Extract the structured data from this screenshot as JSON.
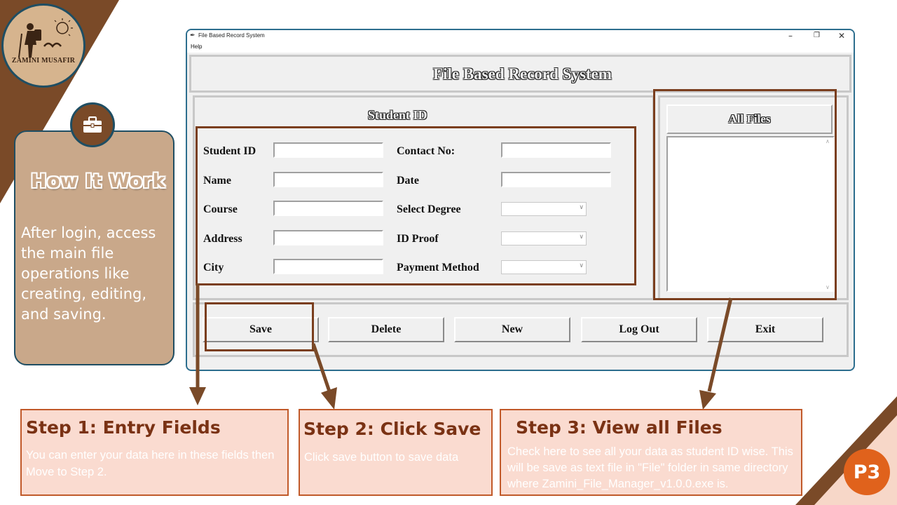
{
  "colors": {
    "accent_brown": "#7a4a28",
    "card_fill": "#c9a88a",
    "window_border": "#2d6e8e",
    "step_fill": "#fadbd0",
    "step_border": "#c15a2a",
    "badge": "#e0621c"
  },
  "logo": {
    "text": "ZAMINI MUSAFIR",
    "icon": "traveler-logo"
  },
  "how_it_works": {
    "icon": "briefcase-icon",
    "title": "How It Work",
    "description": "After login, access the main file operations like creating, editing, and saving."
  },
  "window": {
    "title": "File Based Record System",
    "controls": [
      "–",
      "❐",
      "✕"
    ],
    "menu": [
      "Help"
    ],
    "header_title": "File Based Record System",
    "form_title": "Student ID",
    "fields_left": [
      {
        "label": "Student ID",
        "value": ""
      },
      {
        "label": "Name",
        "value": ""
      },
      {
        "label": "Course",
        "value": ""
      },
      {
        "label": "Address",
        "value": ""
      },
      {
        "label": "City",
        "value": ""
      }
    ],
    "fields_right": [
      {
        "label": "Contact No:",
        "type": "entry",
        "value": ""
      },
      {
        "label": "Date",
        "type": "entry",
        "value": ""
      },
      {
        "label": "Select Degree",
        "type": "combo",
        "value": ""
      },
      {
        "label": "ID Proof",
        "type": "combo",
        "value": ""
      },
      {
        "label": "Payment Method",
        "type": "combo",
        "value": ""
      }
    ],
    "files_title": "All Files",
    "buttons": [
      "Save",
      "Delete",
      "New",
      "Log Out",
      "Exit"
    ]
  },
  "steps": [
    {
      "title": "Step 1: Entry Fields",
      "description": "You can enter your data here in these fields then Move to Step 2."
    },
    {
      "title": "Step 2: Click Save",
      "description": "Click save button to save data"
    },
    {
      "title": "Step 3: View all Files",
      "description": "Check here to see all your data as student ID wise. This will be save as text file in \"File\" folder in same directory where Zamini_File_Manager_v1.0.0.exe is."
    }
  ],
  "page_badge": "P3"
}
